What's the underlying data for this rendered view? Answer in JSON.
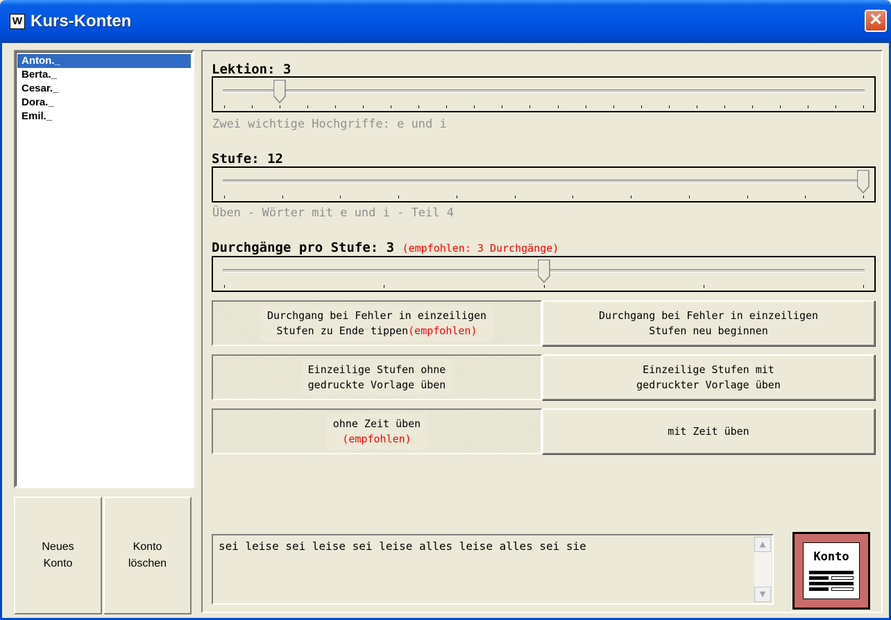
{
  "window": {
    "title": "Kurs-Konten",
    "app_icon_letter": "W",
    "close_symbol": "✕"
  },
  "accounts": [
    "Anton._",
    "Berta._",
    "Cesar._",
    "Dora._",
    "Emil._"
  ],
  "selected_account": "Anton._",
  "buttons": {
    "new_account": "Neues Konto",
    "delete_account": "Konto löschen"
  },
  "lektion": {
    "label": "Lektion: 3",
    "value": 3,
    "min": 1,
    "max": 24,
    "description": "Zwei wichtige Hochgriffe: e und i"
  },
  "stufe": {
    "label": "Stufe: 12",
    "value": 12,
    "min": 1,
    "max": 12,
    "description": "Üben - Wörter mit e und i - Teil 4"
  },
  "durchgaenge": {
    "label": "Durchgänge pro Stufe: 3",
    "recommendation": "(empfohlen: 3 Durchgänge)",
    "value": 3,
    "min": 1,
    "max": 5
  },
  "options": {
    "fehler_ende_line1": "Durchgang bei Fehler in einzeiligen",
    "fehler_ende_line2": "Stufen zu Ende tippen",
    "fehler_ende_rec": "(empfohlen)",
    "fehler_neu_line1": "Durchgang bei Fehler in einzeiligen",
    "fehler_neu_line2": "Stufen neu beginnen",
    "ohne_vorlage_line1": "Einzeilige Stufen ohne",
    "ohne_vorlage_line2": "gedruckte Vorlage üben",
    "mit_vorlage_line1": "Einzeilige Stufen mit",
    "mit_vorlage_line2": "gedruckter Vorlage üben",
    "ohne_zeit": "ohne Zeit üben",
    "ohne_zeit_rec": "(empfohlen)",
    "mit_zeit": "mit Zeit üben"
  },
  "preview_text": "sei leise sei leise sei leise alles leise alles sei sie",
  "konto_badge": "Konto",
  "colors": {
    "titlebar": "#0055e5",
    "selection": "#316ac5",
    "recommend": "#ff0000",
    "konto_bg": "#c96b68"
  }
}
